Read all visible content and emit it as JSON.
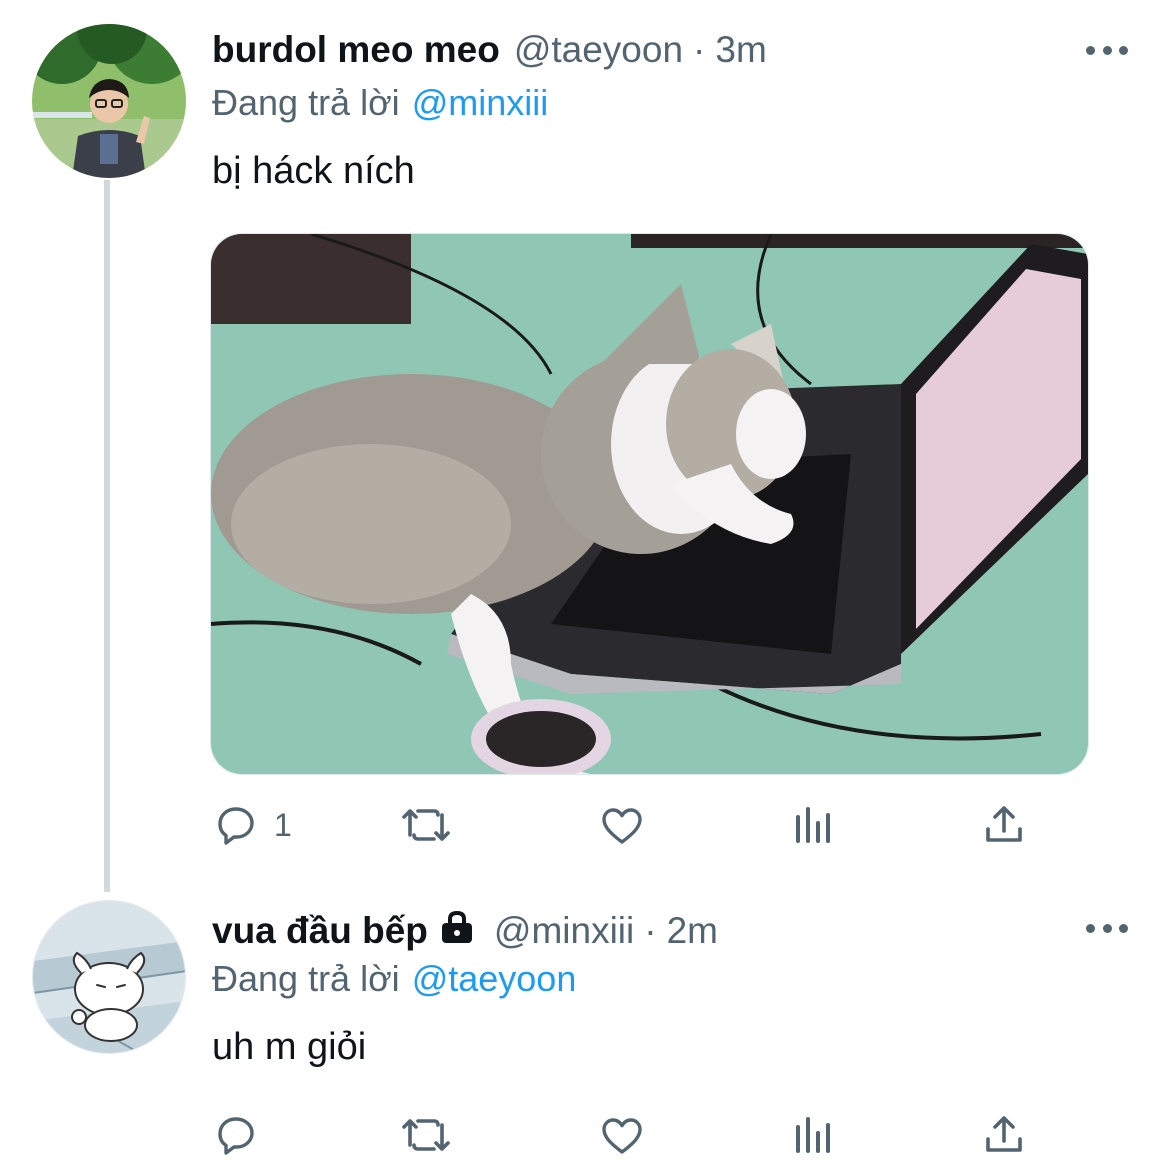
{
  "tweets": [
    {
      "display_name": "burdol meo meo",
      "handle": "@taeyoon",
      "separator": "·",
      "time": "3m",
      "replying_prefix": "Đang trả lời",
      "replying_to": "@minxiii",
      "text": "bị háck ních",
      "has_media": true,
      "reply_count": "1",
      "locked": false,
      "avatar_icon": "person-avatar-icon"
    },
    {
      "display_name": "vua đầu bếp",
      "handle": "@minxiii",
      "separator": "·",
      "time": "2m",
      "replying_prefix": "Đang trả lời",
      "replying_to": "@taeyoon",
      "text": "uh m giỏi",
      "has_media": false,
      "reply_count": "",
      "locked": true,
      "avatar_icon": "cartoon-dog-avatar-icon"
    }
  ],
  "icons": {
    "reply": "reply-icon",
    "retweet": "retweet-icon",
    "like": "like-icon",
    "views": "views-icon",
    "share": "share-icon",
    "more": "more-icon",
    "lock": "lock-icon"
  },
  "colors": {
    "link": "#1d9bf0",
    "secondary": "#536471",
    "text": "#0f1419",
    "thread_line": "#cfd9de"
  }
}
